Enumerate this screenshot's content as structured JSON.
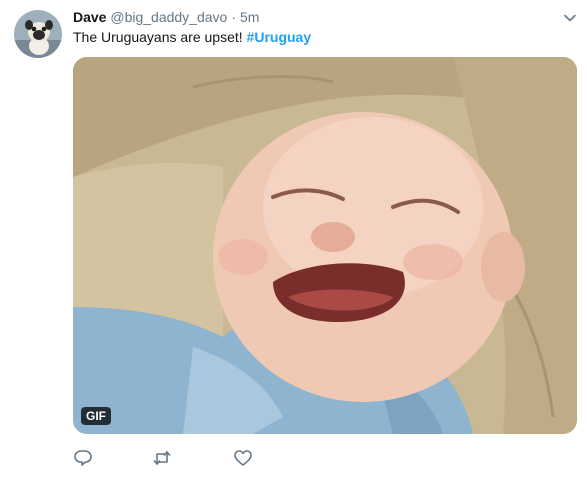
{
  "tweet": {
    "author": {
      "name": "Dave",
      "handle": "@big_daddy_davo",
      "separator": "·",
      "time": "5m",
      "avatar_icon": "pug-avatar"
    },
    "text_before_hashtag": "The Uruguayans are upset!",
    "hashtag": "#Uruguay",
    "media": {
      "badge": "GIF",
      "icon": "crying-baby-gif"
    },
    "actions": {
      "reply_icon": "reply-icon",
      "retweet_icon": "retweet-icon",
      "like_icon": "heart-icon"
    },
    "menu_icon": "chevron-down-icon"
  },
  "colors": {
    "accent": "#1da1f2",
    "secondary_text": "#657786",
    "primary_text": "#14171a",
    "action_icon": "#657786"
  }
}
